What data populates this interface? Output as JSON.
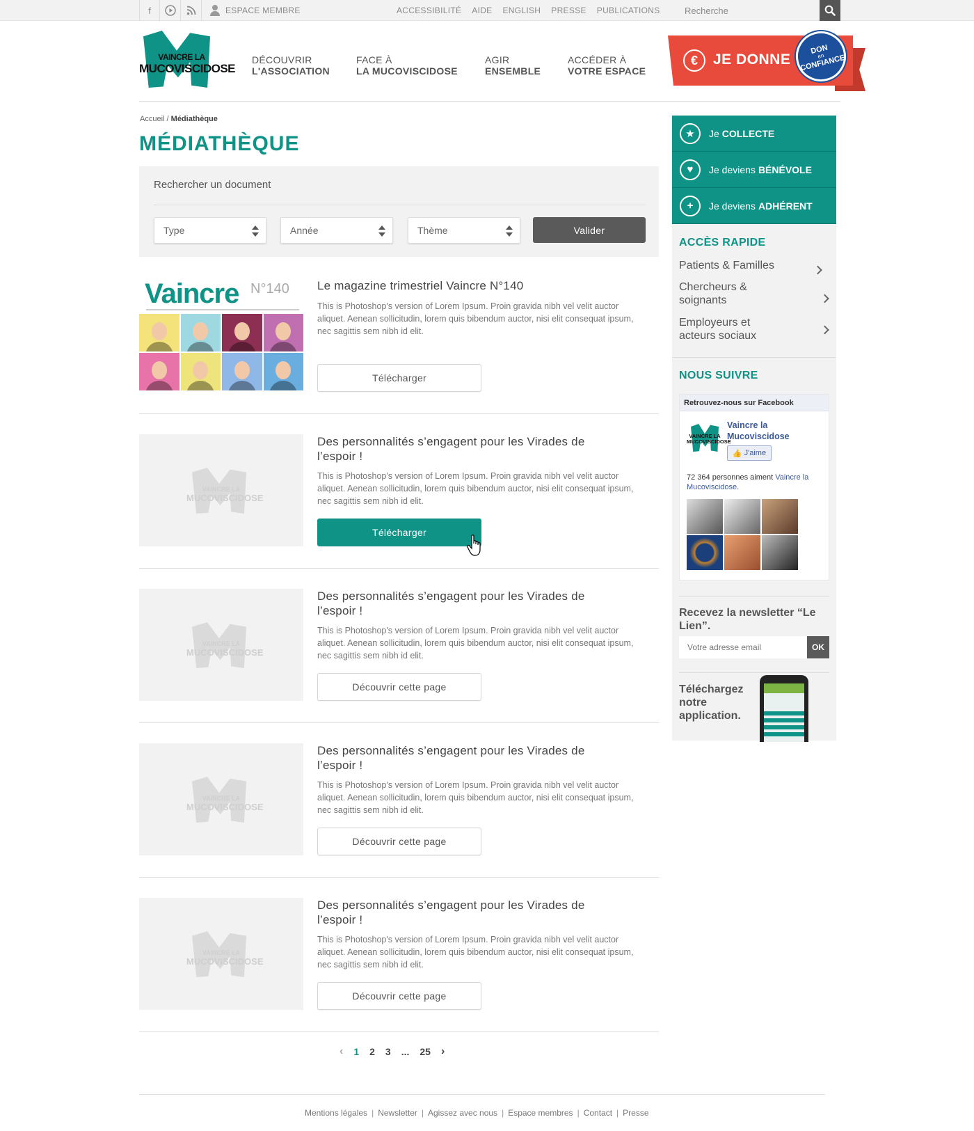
{
  "topbar": {
    "social_icons": [
      "facebook-icon",
      "play-icon",
      "rss-icon"
    ],
    "member_space": "ESPACE MEMBRE",
    "links": [
      "ACCESSIBILITÉ",
      "AIDE",
      "ENGLISH",
      "PRESSE",
      "PUBLICATIONS"
    ],
    "search_placeholder": "Recherche"
  },
  "logo": {
    "line1": "VAINCRE LA",
    "line2": "MUCOVISCIDOSE",
    "color": "#0e9386"
  },
  "nav": [
    {
      "line1": "DÉCOUVRIR",
      "line2": "L'ASSOCIATION"
    },
    {
      "line1": "FACE À",
      "line2": "LA MUCOVISCIDOSE"
    },
    {
      "line1": "AGIR",
      "line2": "ENSEMBLE"
    },
    {
      "line1": "ACCÉDER À",
      "line2": "VOTRE ESPACE"
    }
  ],
  "donate": {
    "label": "JE DONNE",
    "seal_top": "DON",
    "seal_mid": "en",
    "seal_bottom": "CONFIANCE",
    "color": "#e84b3c"
  },
  "breadcrumb": {
    "home": "Accueil",
    "separator": "/",
    "current": "Médiathèque"
  },
  "page_title": "MÉDIATHÈQUE",
  "search": {
    "heading": "Rechercher un document",
    "selects": [
      "Type",
      "Année",
      "Thème"
    ],
    "submit": "Valider"
  },
  "items": [
    {
      "title": "Le magazine trimestriel Vaincre N°140",
      "desc": "This is Photoshop's version  of Lorem Ipsum. Proin gravida nibh vel velit auctor aliquet. Aenean sollicitudin, lorem quis bibendum auctor, nisi elit consequat ipsum, nec sagittis sem nibh id elit.",
      "button": "Télécharger",
      "cover_brand": "Vaincre",
      "cover_num": "N°140"
    },
    {
      "title": "Des personnalités s’engagent pour les Virades de l’espoir !",
      "desc": "This is Photoshop's version  of Lorem Ipsum. Proin gravida nibh vel velit auctor aliquet. Aenean sollicitudin, lorem quis bibendum auctor, nisi elit consequat ipsum, nec sagittis sem nibh id elit.",
      "button": "Télécharger"
    },
    {
      "title": "Des personnalités s’engagent pour les Virades de l’espoir !",
      "desc": "This is Photoshop's version  of Lorem Ipsum. Proin gravida nibh vel velit auctor aliquet. Aenean sollicitudin, lorem quis bibendum auctor, nisi elit consequat ipsum, nec sagittis sem nibh id elit.",
      "button": "Découvrir cette page"
    },
    {
      "title": "Des personnalités s’engagent pour les Virades de l’espoir !",
      "desc": "This is Photoshop's version  of Lorem Ipsum. Proin gravida nibh vel velit auctor aliquet. Aenean sollicitudin, lorem quis bibendum auctor, nisi elit consequat ipsum, nec sagittis sem nibh id elit.",
      "button": "Découvrir cette page"
    },
    {
      "title": "Des personnalités s’engagent pour les Virades de l’espoir !",
      "desc": "This is Photoshop's version  of Lorem Ipsum. Proin gravida nibh vel velit auctor aliquet. Aenean sollicitudin, lorem quis bibendum auctor, nisi elit consequat ipsum, nec sagittis sem nibh id elit.",
      "button": "Découvrir cette page"
    }
  ],
  "pagination": {
    "prev": "‹",
    "pages": [
      "1",
      "2",
      "3",
      "...",
      "25"
    ],
    "current": "1",
    "next": "›"
  },
  "sidebar": {
    "ctas": [
      {
        "prefix": "Je",
        "strong": "COLLECTE",
        "icon": "star-icon"
      },
      {
        "prefix": "Je deviens",
        "strong": "BÉNÉVOLE",
        "icon": "heart-icon"
      },
      {
        "prefix": "Je deviens",
        "strong": "ADHÉRENT",
        "icon": "plus-icon"
      }
    ],
    "quick_access_title": "ACCÈS RAPIDE",
    "quick_links": [
      "Patients & Familles",
      "Chercheurs & soignants",
      "Employeurs et acteurs sociaux"
    ],
    "follow_title": "NOUS SUIVRE",
    "facebook": {
      "header": "Retrouvez-nous sur Facebook",
      "page_name": "Vaincre la Mucoviscidose",
      "like": "J'aime",
      "count_text": "72 364 personnes aiment",
      "count_link": "Vaincre la Mucoviscidose",
      "count_end": "."
    },
    "newsletter_title": "Recevez la newsletter “Le Lien”.",
    "newsletter_placeholder": "Votre adresse email",
    "newsletter_ok": "OK",
    "app_title": "Téléchargez notre application."
  },
  "footer": [
    "Mentions légales",
    "Newsletter",
    "Agissez avec nous",
    "Espace membres",
    "Contact",
    "Presse"
  ]
}
